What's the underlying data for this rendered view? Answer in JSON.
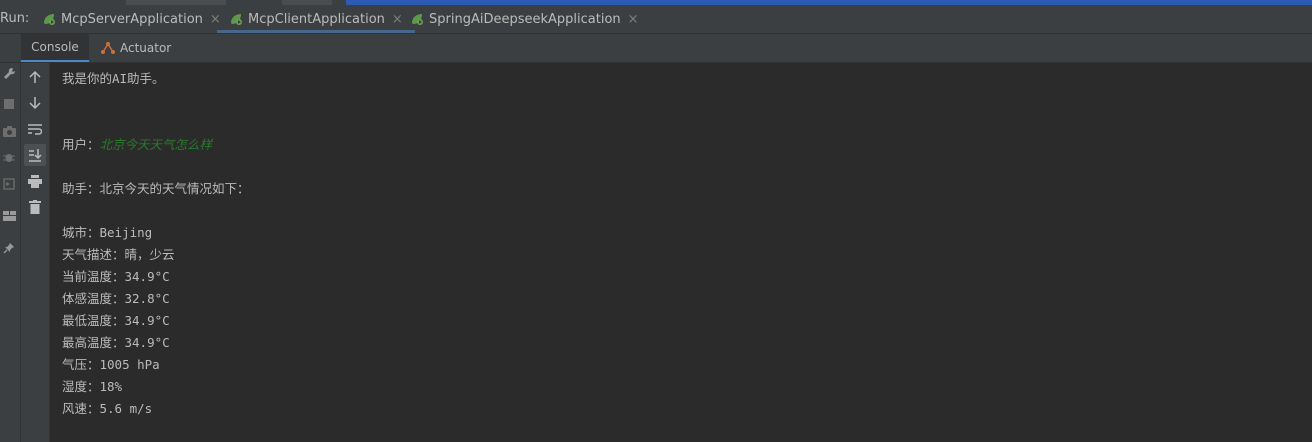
{
  "run_bar": {
    "label": "Run:",
    "tabs": [
      {
        "label": "McpServerApplication",
        "icon": "spring-boot-icon"
      },
      {
        "label": "McpClientApplication",
        "icon": "spring-boot-icon",
        "active": true
      },
      {
        "label": "SpringAiDeepseekApplication",
        "icon": "spring-boot-icon"
      }
    ],
    "close_glyph": "×"
  },
  "console_bar": {
    "tabs": [
      {
        "label": "Console",
        "active": true
      },
      {
        "label": "Actuator",
        "icon": "actuator-icon"
      }
    ]
  },
  "console": {
    "greeting": "我是你的AI助手。",
    "user_prefix": "用户：",
    "user_message": "北京今天天气怎么样",
    "assistant_intro": "助手：北京今天的天气情况如下：",
    "weather_lines": [
      "城市：Beijing",
      "天气描述：晴，少云",
      "当前温度：34.9°C",
      "体感温度：32.8°C",
      "最低温度：34.9°C",
      "最高温度：34.9°C",
      "气压：1005 hPa",
      "湿度：18%",
      "风速：5.6 m/s"
    ]
  },
  "colors": {
    "background": "#2b2b2b",
    "panel": "#3c3f41",
    "text": "#bbbbbb",
    "user_input": "#287b2a",
    "accent": "#4a88c7"
  }
}
